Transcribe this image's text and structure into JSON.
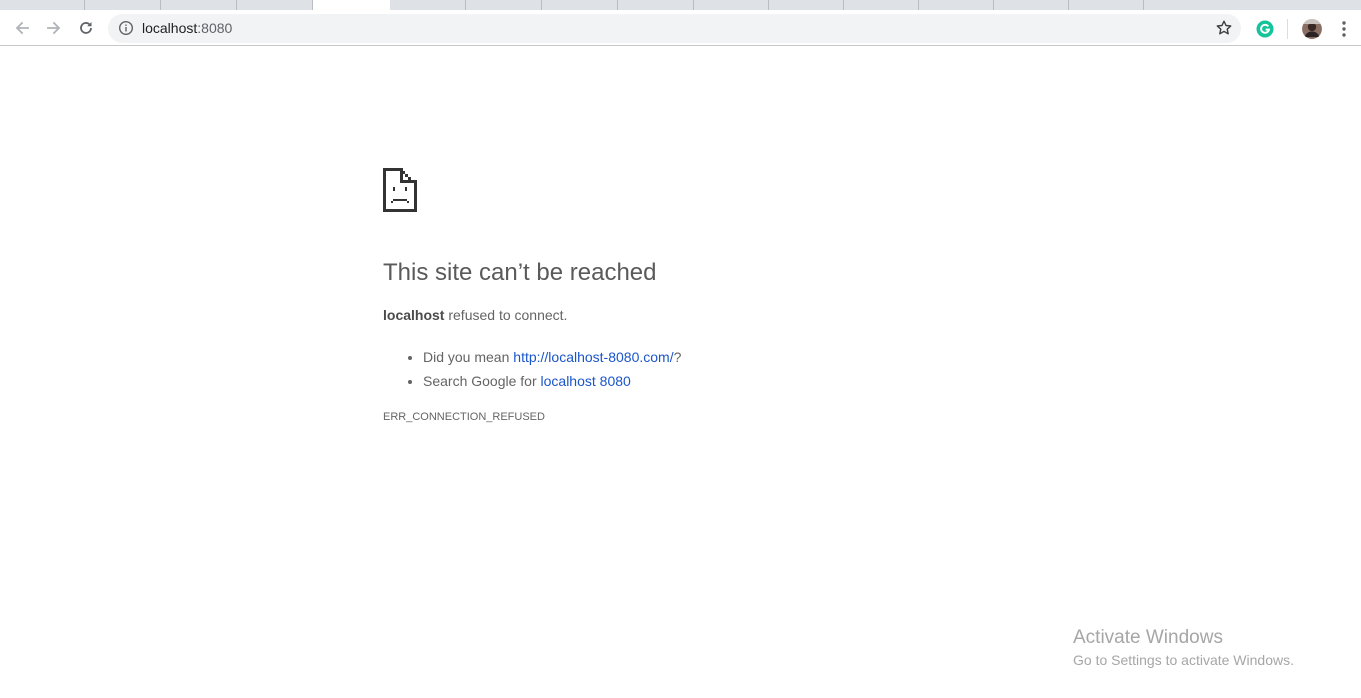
{
  "browser": {
    "back_icon": "arrow-left-icon",
    "forward_icon": "arrow-right-icon",
    "reload_icon": "reload-icon",
    "info_icon": "info-circle-icon",
    "bookmark_icon": "star-outline-icon",
    "extension_icon": "grammarly-g-icon",
    "profile_icon": "avatar-icon",
    "menu_icon": "three-dot-menu-icon",
    "url": {
      "host": "localhost",
      "port": ":8080"
    }
  },
  "error_page": {
    "icon": "sad-page-icon",
    "title": "This site can’t be reached",
    "summary": {
      "host": "localhost",
      "message": " refused to connect."
    },
    "suggestions": {
      "did_you_mean_prefix": "Did you mean ",
      "did_you_mean_link": "http://localhost-8080.com/",
      "did_you_mean_suffix": "?",
      "search_prefix": "Search Google for ",
      "search_link": "localhost 8080"
    },
    "error_code": "ERR_CONNECTION_REFUSED"
  },
  "watermark": {
    "title": "Activate Windows",
    "subtitle": "Go to Settings to activate Windows."
  },
  "colors": {
    "link": "#1a55c9",
    "title": "#5a5a5a",
    "body_text": "#646464",
    "extension_green": "#15c39a"
  }
}
